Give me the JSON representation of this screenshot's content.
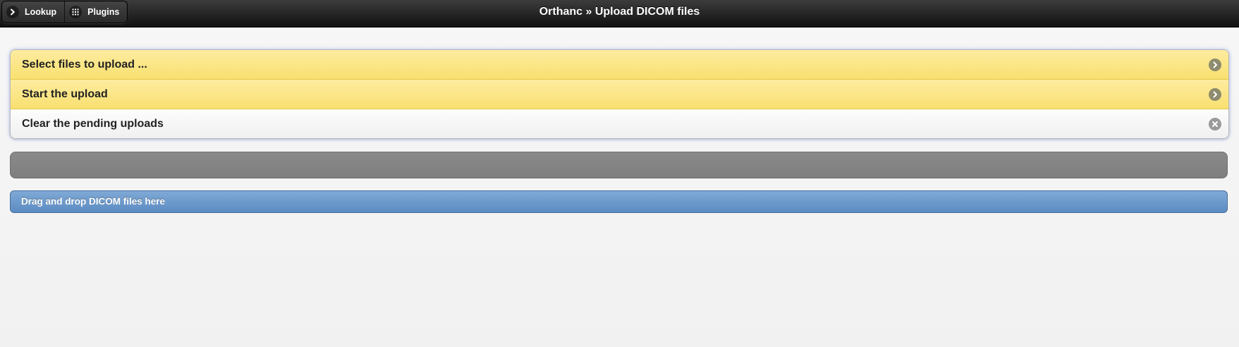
{
  "header": {
    "title": "Orthanc » Upload DICOM files",
    "buttons": [
      {
        "label": "Lookup",
        "icon": "chevron-right-icon"
      },
      {
        "label": "Plugins",
        "icon": "grid-icon"
      }
    ]
  },
  "actions": [
    {
      "label": "Select files to upload ...",
      "icon": "arrow-right-icon",
      "style": "yellow"
    },
    {
      "label": "Start the upload",
      "icon": "arrow-right-icon",
      "style": "yellow"
    },
    {
      "label": "Clear the pending uploads",
      "icon": "delete-icon",
      "style": "white"
    }
  ],
  "progress": {
    "value": 0
  },
  "dropzone": {
    "label": "Drag and drop DICOM files here"
  },
  "colors": {
    "header": "#1e1e1e",
    "yellow": "#f9e070",
    "progress_track": "#828282",
    "dropzone": "#6a97c9"
  }
}
